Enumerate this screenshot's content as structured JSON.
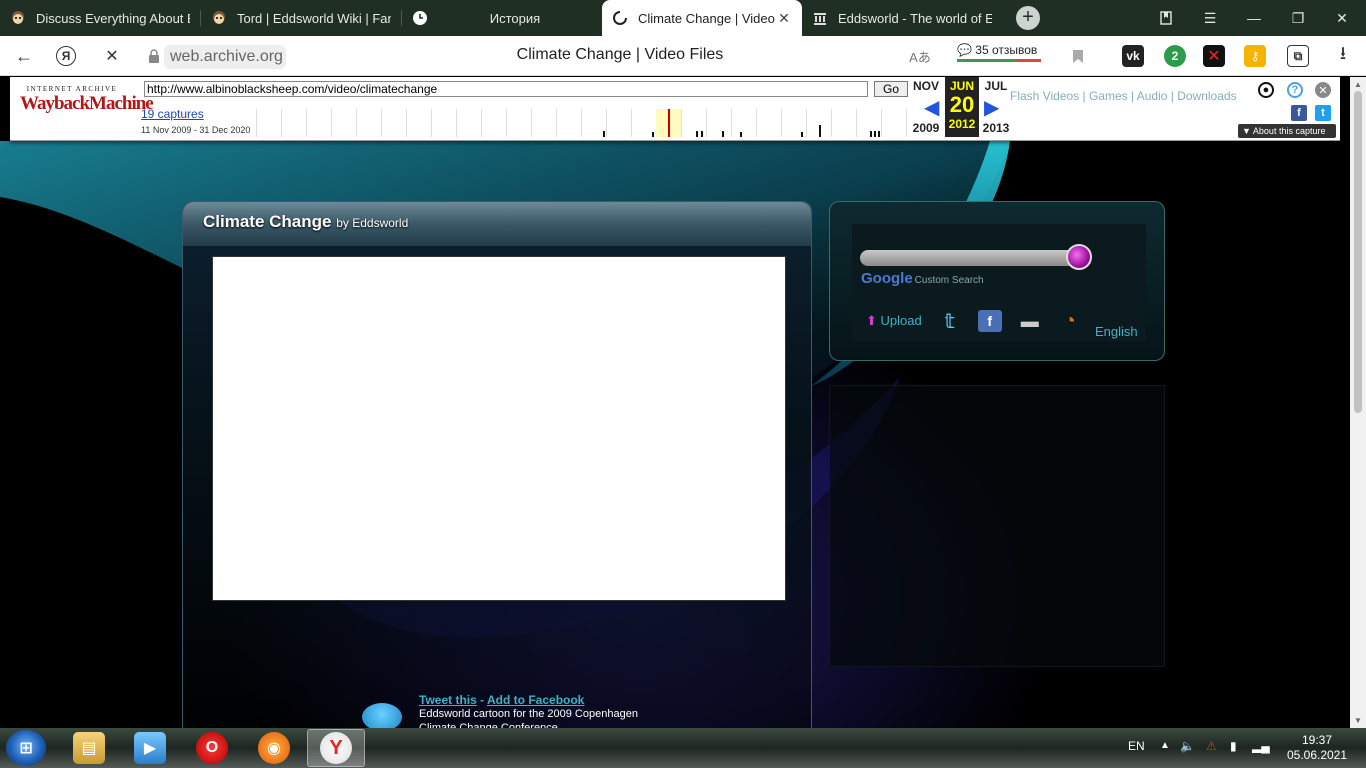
{
  "tabs": [
    {
      "title": "Discuss Everything About E",
      "icon": "eddsworld-avatar-icon",
      "active": false
    },
    {
      "title": "Tord | Eddsworld Wiki | Fan",
      "icon": "eddsworld-avatar-icon",
      "active": false
    },
    {
      "title": "История",
      "icon": "clock-icon",
      "active": false
    },
    {
      "title": "Climate Change | Video",
      "icon": "loading-spinner-icon",
      "active": true
    },
    {
      "title": "Eddsworld - The world of E",
      "icon": "archive-building-icon",
      "active": false
    }
  ],
  "new_tab": "+",
  "window_controls": {
    "minimize": "—",
    "maximize": "❐",
    "close": "✕"
  },
  "address_bar": {
    "domain": "web.archive.org",
    "page_title": "Climate Change | Video Files",
    "reviews": "35 отзывов"
  },
  "wayback": {
    "logo_top": "INTERNET ARCHIVE",
    "logo_main": "WaybackMachine",
    "url": "http://www.albinoblacksheep.com/video/climatechange",
    "go": "Go",
    "captures": "19 captures",
    "range": "11 Nov 2009 - 31 Dec 2020",
    "prev_month": "NOV",
    "cur_month": "JUN",
    "next_month": "JUL",
    "cur_day": "20",
    "prev_year": "2009",
    "cur_year": "2012",
    "next_year": "2013",
    "about": "About this capture"
  },
  "site_nav_ghost": "Flash Videos   |   Games   |   Audio   |   Downloads",
  "video": {
    "title": "Climate Change",
    "by": "by Eddsworld"
  },
  "sidebar": {
    "search_value": "",
    "google_label": "Google",
    "custom_search": "Custom Search",
    "upload": "Upload",
    "language": "English"
  },
  "share": {
    "tweet": "Tweet this",
    "sep": " - ",
    "facebook": "Add to Facebook",
    "description": "Eddsworld cartoon for the 2009 Copenhagen Climate Change Conference"
  },
  "taskbar": {
    "lang": "EN",
    "time": "19:37",
    "date": "05.06.2021"
  }
}
